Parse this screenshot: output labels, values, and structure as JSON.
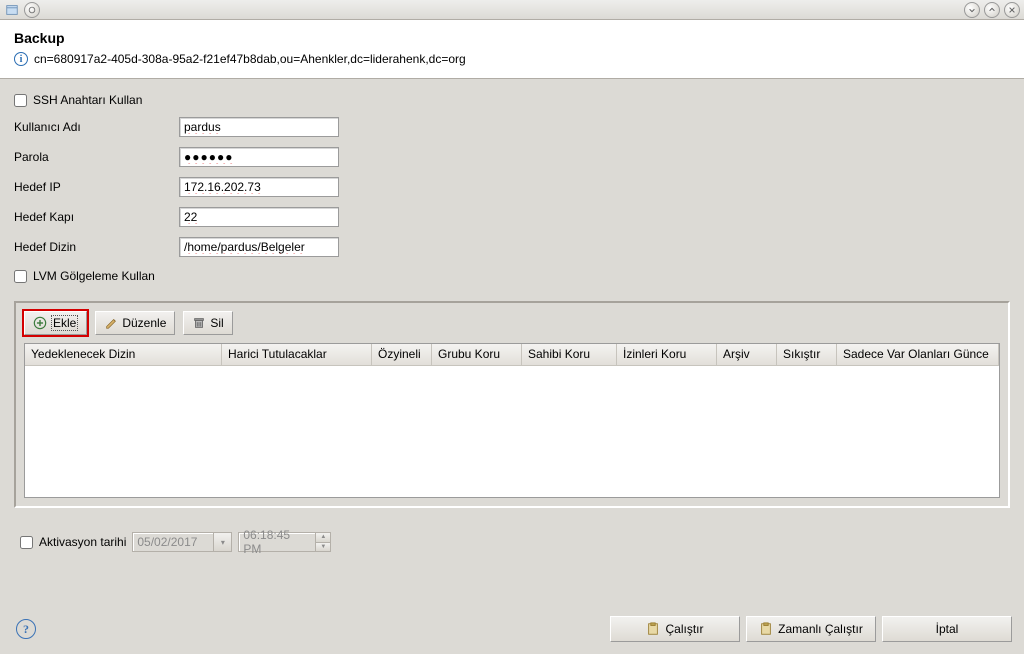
{
  "header": {
    "title": "Backup",
    "dn": "cn=680917a2-405d-308a-95a2-f21ef47b8dab,ou=Ahenkler,dc=liderahenk,dc=org"
  },
  "form": {
    "ssh_key_label": "SSH Anahtarı Kullan",
    "username_label": "Kullanıcı Adı",
    "username_value": "pardus",
    "password_label": "Parola",
    "password_value": "●●●●●●",
    "target_ip_label": "Hedef IP",
    "target_ip_value": "172.16.202.73",
    "target_port_label": "Hedef Kapı",
    "target_port_value": "22",
    "target_dir_label": "Hedef Dizin",
    "target_dir_value": "/home/pardus/Belgeler",
    "lvm_label": "LVM Gölgeleme Kullan"
  },
  "toolbar": {
    "add_label": "Ekle",
    "edit_label": "Düzenle",
    "delete_label": "Sil"
  },
  "table": {
    "headers": [
      "Yedeklenecek Dizin",
      "Harici Tutulacaklar",
      "Özyineli",
      "Grubu Koru",
      "Sahibi Koru",
      "İzinleri Koru",
      "Arşiv",
      "Sıkıştır",
      "Sadece Var Olanları Günce"
    ]
  },
  "activation": {
    "label": "Aktivasyon tarihi",
    "date_value": "05/02/2017",
    "time_value": "06:18:45 PM"
  },
  "buttons": {
    "run_label": "Çalıştır",
    "scheduled_run_label": "Zamanlı Çalıştır",
    "cancel_label": "İptal"
  }
}
